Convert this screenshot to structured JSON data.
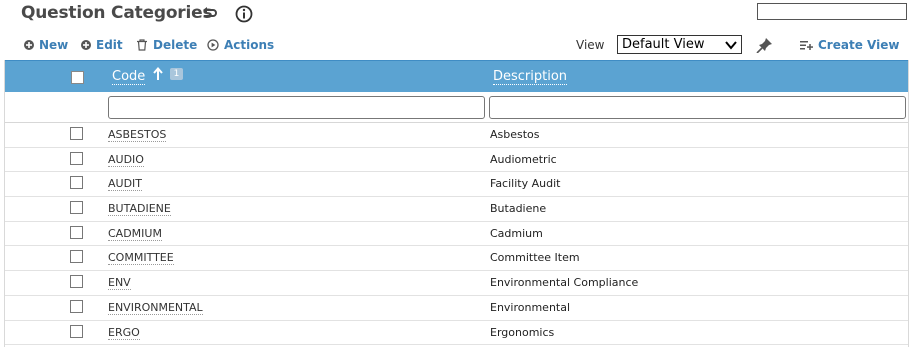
{
  "page": {
    "title": "Question Categories",
    "undo_icon": "undo-arrow-icon",
    "info_icon": "info-circle-icon"
  },
  "search": {
    "value": "",
    "placeholder": ""
  },
  "toolbar": {
    "new_label": "New",
    "edit_label": "Edit",
    "delete_label": "Delete",
    "actions_label": "Actions",
    "view_label": "View",
    "view_selected": "Default View",
    "create_view_label": "Create View",
    "accent_color": "#3d7fb5"
  },
  "grid": {
    "header_color": "#5ba3d2",
    "columns": {
      "code": "Code",
      "description": "Description"
    },
    "sort": {
      "column": "Code",
      "direction": "ascending",
      "priority": "1"
    },
    "filters": {
      "code": "",
      "description": ""
    },
    "rows": [
      {
        "code": "ASBESTOS",
        "description": "Asbestos"
      },
      {
        "code": "AUDIO",
        "description": "Audiometric"
      },
      {
        "code": "AUDIT",
        "description": "Facility Audit"
      },
      {
        "code": "BUTADIENE",
        "description": "Butadiene"
      },
      {
        "code": "CADMIUM",
        "description": "Cadmium"
      },
      {
        "code": "COMMITTEE",
        "description": "Committee Item"
      },
      {
        "code": "ENV",
        "description": "Environmental Compliance"
      },
      {
        "code": "ENVIRONMENTAL",
        "description": "Environmental"
      },
      {
        "code": "ERGO",
        "description": "Ergonomics"
      }
    ]
  }
}
